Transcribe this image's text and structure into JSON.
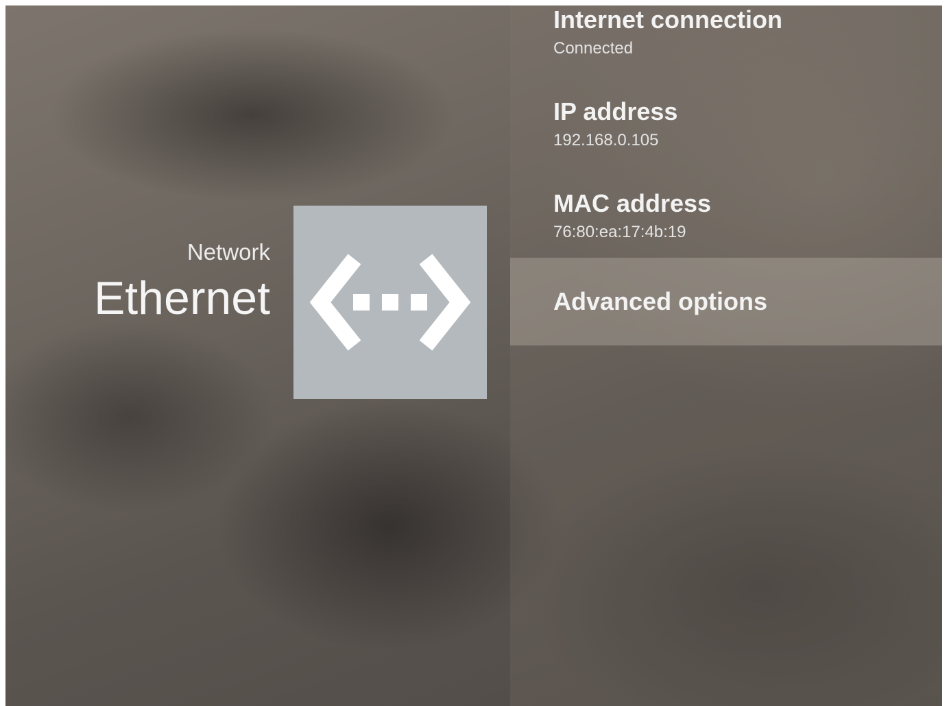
{
  "header": {
    "breadcrumb": "Network",
    "title": "Ethernet"
  },
  "icon": {
    "name": "ethernet-icon",
    "tile_color": "#b4b9bd"
  },
  "menu": {
    "items": [
      {
        "title": "Internet connection",
        "subtitle": "Connected"
      },
      {
        "title": "IP address",
        "subtitle": "192.168.0.105"
      },
      {
        "title": "MAC address",
        "subtitle": "76:80:ea:17:4b:19"
      },
      {
        "title": "Advanced options"
      }
    ]
  }
}
